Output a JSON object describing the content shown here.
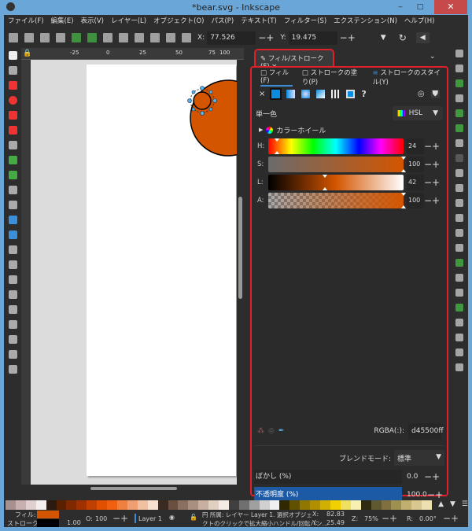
{
  "window": {
    "title": "*bear.svg - Inkscape",
    "minimize": "‒",
    "maximize": "□",
    "close": "✕"
  },
  "menu": [
    "ファイル(F)",
    "編集(E)",
    "表示(V)",
    "レイヤー(L)",
    "オブジェクト(O)",
    "パス(P)",
    "テキスト(T)",
    "フィルター(S)",
    "エクステンション(N)",
    "ヘルプ(H)"
  ],
  "toolbar": {
    "x_label": "X:",
    "x_value": "77.526",
    "y_label": "Y:",
    "y_value": "19.475"
  },
  "ruler": [
    "-25",
    "0",
    "25",
    "50",
    "75",
    "100"
  ],
  "dock": {
    "tab_label": "フィル/ストローク(F)",
    "tab_close": "×",
    "subtabs": [
      "フィル(F)",
      "ストロークの塗り(P)",
      "ストロークのスタイル(Y)"
    ],
    "paint_none": "×",
    "paint_unknown": "?",
    "mode_label": "単一色",
    "color_mode": "HSL",
    "wheel_label": "カラーホイール",
    "sliders": [
      {
        "label": "H:",
        "value": "24"
      },
      {
        "label": "S:",
        "value": "100"
      },
      {
        "label": "L:",
        "value": "42"
      },
      {
        "label": "A:",
        "value": "100"
      }
    ],
    "rgba_label": "RGBA(:):",
    "rgba_value": "d45500ff",
    "blend_label": "ブレンドモード:",
    "blend_value": "標準",
    "blur_label": "ぼかし (%)",
    "blur_value": "0.0",
    "opacity_label": "不透明度 (%)",
    "opacity_value": "100.0"
  },
  "colors": {
    "fill": "#d45500",
    "stroke": "#000000",
    "accent": "#3b8fd9",
    "highlight": "#e0202a"
  },
  "status": {
    "fill_label": "フィル:",
    "stroke_label": "ストローク:",
    "stroke_width": "1.00",
    "opacity_label": "O:",
    "opacity_value": "100",
    "layer": "Layer 1",
    "message_line1": "円 所属: レイヤー Layer 1. 選択オブジェ",
    "message_line2": "クトのクリックで拡大縮小ハンドル/回転ハン…",
    "cx_label": "X:",
    "cx": "82.83",
    "cy_label": "Y:",
    "cy": "25.49",
    "zoom_label": "Z:",
    "zoom": "75%",
    "rot_label": "R:",
    "rotation": "0.00°"
  }
}
